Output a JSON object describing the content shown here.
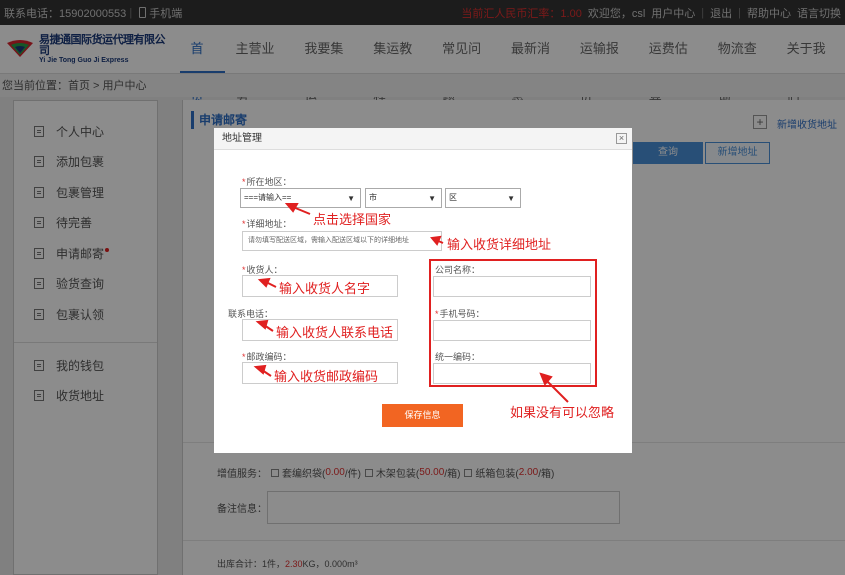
{
  "topbar": {
    "contact": "联系电话：15902000553",
    "mobile": "手机端",
    "rate": "当前汇人民币汇率：1.00",
    "welcome": "欢迎您，csl",
    "user_center": "用户中心",
    "logout": "退出",
    "help": "帮助中心",
    "lang": "语言切换"
  },
  "brand": {
    "name_cn": "易捷通国际货运代理有限公司",
    "name_en": "Yi Jie Tong Guo Ji Express",
    "colors": {
      "red": "#d9232e",
      "blue": "#1a3a7a",
      "green": "#2a9d4a"
    }
  },
  "nav": {
    "items": [
      "首页",
      "主营业务",
      "我要集运",
      "集运教程",
      "常见问题",
      "最新消息",
      "运输报价",
      "运费估算",
      "物流查询",
      "关于我们"
    ],
    "active": "首页"
  },
  "breadcrumb": "您当前位置：首页 > 用户中心",
  "sidebar": {
    "items": [
      "个人中心",
      "添加包裹",
      "包裹管理",
      "待完善",
      "申请邮寄",
      "验货查询",
      "包裹认领",
      "我的钱包",
      "收货地址"
    ]
  },
  "main": {
    "title": "申请邮寄",
    "plus": "+",
    "add_address_link": "新增收货地址",
    "query_btn": "查询",
    "new_addr_btn": "新增地址",
    "value_added": {
      "label": "增值服务：",
      "opt1": "套编织袋(",
      "opt1_price": "0.00",
      "opt1_unit": "/件)",
      "opt2": "木架包装(",
      "opt2_price": "50.00",
      "opt2_unit": "/箱)",
      "opt3": "纸箱包装(",
      "opt3_price": "2.00",
      "opt3_unit": "/箱)"
    },
    "note_label": "备注信息：",
    "total_label": "出库合计：1件，",
    "total_weight": "2.30",
    "total_rest": "KG，0.000m³"
  },
  "modal": {
    "title": "地址管理",
    "close": "×",
    "region_label": "所在地区：",
    "country_select": "===请输入==",
    "city_select": "市",
    "district_select": "区",
    "address_label": "详细地址：",
    "address_placeholder": "请勿填写配送区域，需输入配送区域以下的详细地址",
    "consignee_label": "收货人：",
    "phone_label": "联系电话：",
    "postcode_label": "邮政编码：",
    "company_label": "公司名称：",
    "mobile_label": "手机号码：",
    "uscc_label": "统一编码：",
    "save_btn": "保存信息"
  },
  "annotations": {
    "country": "点击选择国家",
    "address": "输入收货详细地址",
    "consignee": "输入收货人名字",
    "phone": "输入收货人联系电话",
    "postcode": "输入收货邮政编码",
    "optional": "如果没有可以忽略",
    "color": "#e02020"
  }
}
